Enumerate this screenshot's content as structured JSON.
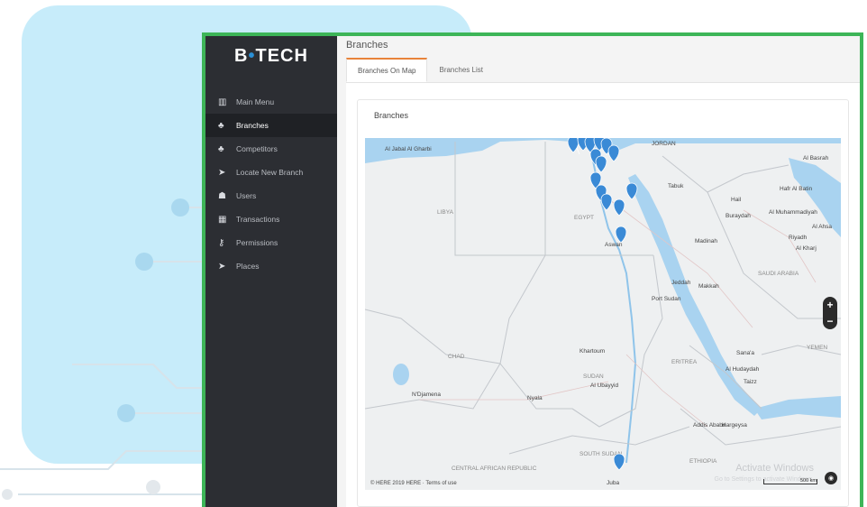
{
  "app": {
    "logo_text": "B",
    "logo_dot": "•",
    "logo_rest": "TECH"
  },
  "sidebar": {
    "items": [
      {
        "label": "Main Menu",
        "icon": "bar-chart-icon",
        "glyph": "▥"
      },
      {
        "label": "Branches",
        "icon": "sitemap-icon",
        "glyph": "♣",
        "active": true
      },
      {
        "label": "Competitors",
        "icon": "sitemap-icon",
        "glyph": "♣"
      },
      {
        "label": "Locate New Branch",
        "icon": "location-arrow-icon",
        "glyph": "➤"
      },
      {
        "label": "Users",
        "icon": "users-icon",
        "glyph": "☗"
      },
      {
        "label": "Transactions",
        "icon": "table-icon",
        "glyph": "▦"
      },
      {
        "label": "Permissions",
        "icon": "key-icon",
        "glyph": "⚷"
      },
      {
        "label": "Places",
        "icon": "location-arrow-icon",
        "glyph": "➤"
      }
    ]
  },
  "header": {
    "title": "Branches"
  },
  "tabs": [
    {
      "label": "Branches On Map",
      "active": true
    },
    {
      "label": "Branches List",
      "active": false
    }
  ],
  "card": {
    "title": "Branches"
  },
  "map": {
    "zoom_in": "+",
    "zoom_out": "−",
    "attribution": "© HERE 2019 HERE · Terms of use",
    "scale": "500 km",
    "watermark": "Activate Windows",
    "watermark_sub": "Go to Settings to activate Windows.",
    "colors": {
      "water": "#a9d3f0",
      "land": "#eef0f1",
      "border": "#c8cbd0",
      "marker": "#3a8ad6"
    },
    "labels": {
      "al_basrah": "Al Basrah",
      "tabuk": "Tabuk",
      "hail": "Hail",
      "buraydah": "Buraydah",
      "al_muhammadiyah": "Al Muhammadiyah",
      "hafr_al_batin": "Hafr Al Batin",
      "riyadh": "Riyadh",
      "al_kharj": "Al Kharj",
      "ahsa": "Al Ahsa",
      "madinah": "Madinah",
      "saudi_arabia": "SAUDI ARABIA",
      "jeddah": "Jeddah",
      "makkah": "Makkah",
      "port_sudan": "Port Sudan",
      "yemen": "YEMEN",
      "sanaa": "Sana'a",
      "al_hudaydah": "Al Hudaydah",
      "taizz": "Taizz",
      "eritrea": "ERITREA",
      "ethiopia": "ETHIOPIA",
      "addis_ababa": "Addis Ababa",
      "hargeysa": "Hargeysa",
      "libya": "LIBYA",
      "egypt": "EGYPT",
      "aswan": "Aswan",
      "chad": "CHAD",
      "sudan": "SUDAN",
      "khartoum": "Khartoum",
      "al_ubayyid": "Al Ubayyid",
      "nyala": "Nyala",
      "ndjamena": "N'Djamena",
      "south_sudan": "SOUTH SUDAN",
      "juba": "Juba",
      "central_african_republic": "CENTRAL AFRICAN REPUBLIC",
      "al_jabal_al_gharbi": "Al Jabal Al Gharbi",
      "jordan": "JORDAN"
    }
  }
}
